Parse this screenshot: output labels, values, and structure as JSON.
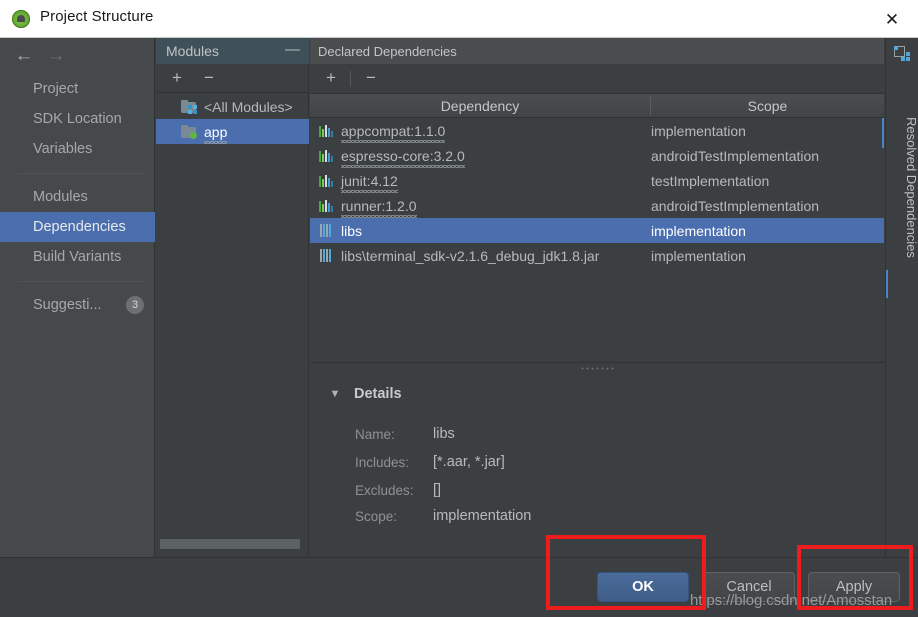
{
  "window": {
    "title": "Project Structure",
    "icon": "android-studio-icon",
    "close_label": "✕"
  },
  "leftnav": {
    "back_icon": "←",
    "forward_icon": "→",
    "items": [
      {
        "label": "Project",
        "selected": false
      },
      {
        "label": "SDK Location",
        "selected": false
      },
      {
        "label": "Variables",
        "selected": false
      },
      {
        "label": "Modules",
        "selected": false
      },
      {
        "label": "Dependencies",
        "selected": true
      },
      {
        "label": "Build Variants",
        "selected": false
      },
      {
        "label": "Suggesti...",
        "selected": false,
        "badge": "3"
      }
    ]
  },
  "modules": {
    "header": "Modules",
    "collapse_icon": "—",
    "add_icon": "+",
    "remove_icon": "−",
    "items": [
      {
        "label": "<All Modules>",
        "icon": "folder-modules-icon",
        "selected": false
      },
      {
        "label": "app",
        "icon": "folder-app-icon",
        "selected": true
      }
    ]
  },
  "dependencies": {
    "header": "Declared Dependencies",
    "add_icon": "+",
    "remove_icon": "−",
    "columns": [
      "Dependency",
      "Scope"
    ],
    "rows": [
      {
        "dependency": "appcompat:1.1.0",
        "scope": "implementation",
        "icon": "library-icon",
        "selected": false
      },
      {
        "dependency": "espresso-core:3.2.0",
        "scope": "androidTestImplementation",
        "icon": "library-icon",
        "selected": false
      },
      {
        "dependency": "junit:4.12",
        "scope": "testImplementation",
        "icon": "library-icon",
        "selected": false
      },
      {
        "dependency": "runner:1.2.0",
        "scope": "androidTestImplementation",
        "icon": "library-icon",
        "selected": false
      },
      {
        "dependency": "libs",
        "scope": "implementation",
        "icon": "file-library-icon",
        "selected": true
      },
      {
        "dependency": "libs\\terminal_sdk-v2.1.6_debug_jdk1.8.jar",
        "scope": "implementation",
        "icon": "file-library-icon",
        "selected": false
      }
    ]
  },
  "details": {
    "caret": "▼",
    "title": "Details",
    "fields": [
      {
        "key": "Name:",
        "value": "libs"
      },
      {
        "key": "Includes:",
        "value": "[*.aar, *.jar]"
      },
      {
        "key": "Excludes:",
        "value": "[]"
      },
      {
        "key": "Scope:",
        "value": "implementation"
      }
    ]
  },
  "right_tab": {
    "label": "Resolved Dependencies",
    "icon": "resolved-dependencies-icon"
  },
  "footer": {
    "ok": "OK",
    "cancel": "Cancel",
    "apply": "Apply"
  },
  "watermark": "https://blog.csdn.net/Amosstan",
  "colors": {
    "selection_blue": "#4b6eaf",
    "accent_blue": "#4b84c8",
    "annotation_red": "#ee1c1c",
    "panel_bg": "#3c3f41",
    "nav_bg": "#45494a"
  }
}
